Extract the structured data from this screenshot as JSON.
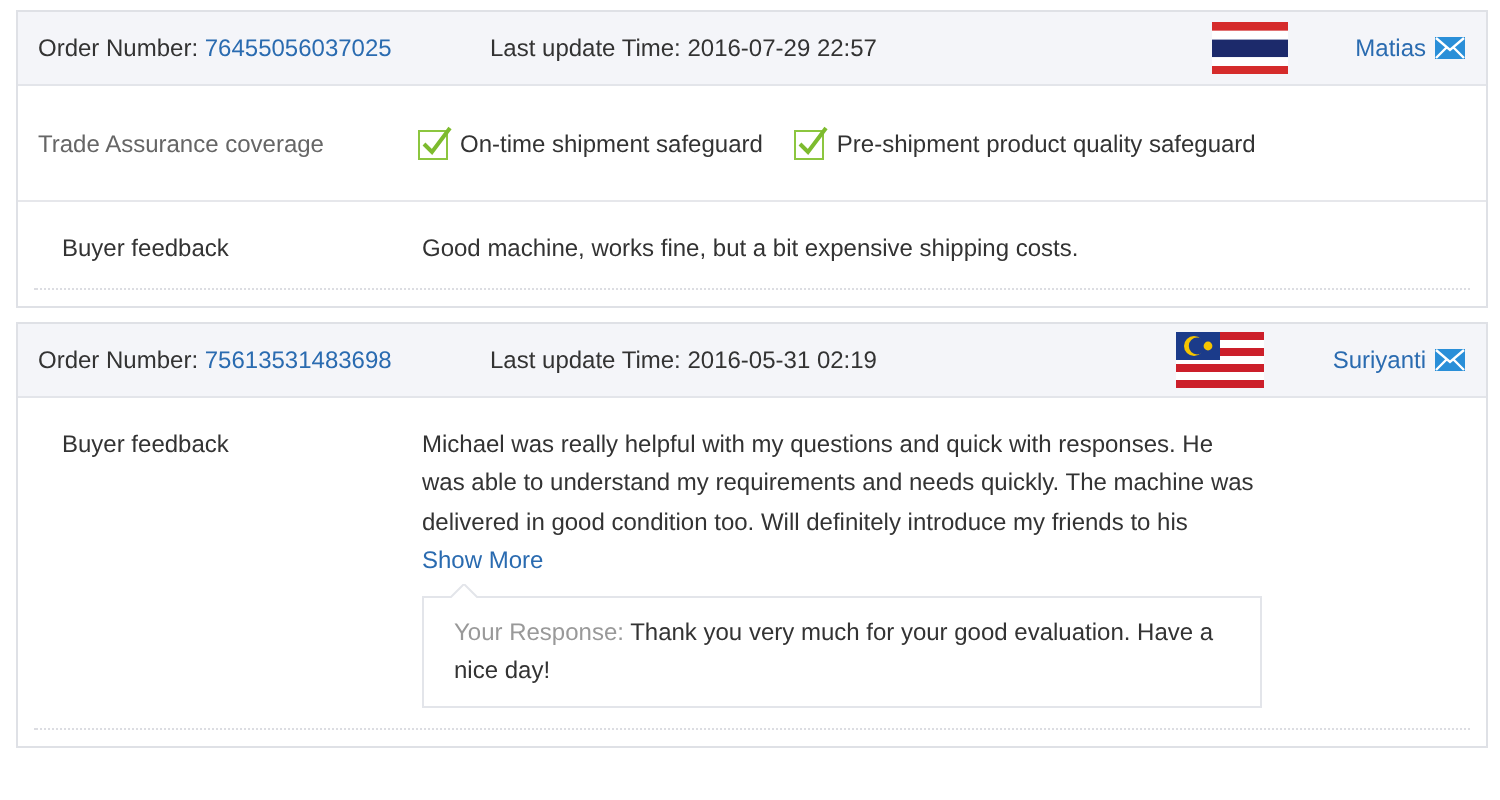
{
  "orders": [
    {
      "order_label": "Order Number:",
      "order_number": "76455056037025",
      "update_label": "Last update Time:",
      "update_time": "2016-07-29 22:57",
      "flag": {
        "kind": "thailand"
      },
      "buyer": "Matias",
      "assurance": {
        "label": "Trade Assurance coverage",
        "items": [
          {
            "text": "On-time shipment safeguard",
            "checked": true
          },
          {
            "text": "Pre-shipment product quality safeguard",
            "checked": true
          }
        ]
      },
      "feedback": {
        "label": "Buyer feedback",
        "text": "Good machine, works fine, but a bit expensive shipping costs."
      }
    },
    {
      "order_label": "Order Number:",
      "order_number": "75613531483698",
      "update_label": "Last update Time:",
      "update_time": "2016-05-31 02:19",
      "flag": {
        "kind": "malaysia"
      },
      "buyer": "Suriyanti",
      "feedback": {
        "label": "Buyer feedback",
        "text": "Michael was really helpful with my questions and quick with responses. He was able to understand my requirements and needs quickly. The machine was delivered in good condition too. Will definitely introduce my friends to his",
        "show_more": "Show More",
        "response": {
          "label": "Your Response:",
          "text": "Thank you very much for your good evaluation. Have a nice day!"
        }
      }
    }
  ]
}
